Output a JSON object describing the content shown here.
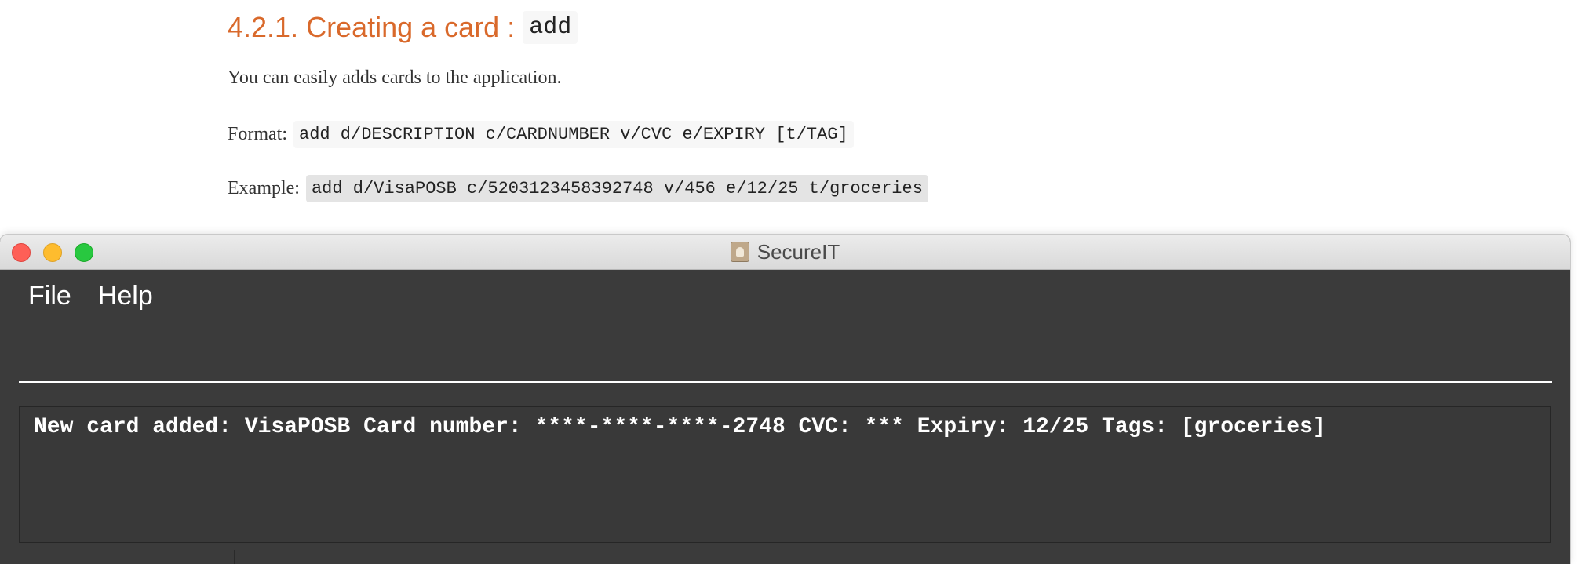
{
  "doc": {
    "heading": "4.2.1. Creating a card :",
    "heading_code": "add",
    "intro": "You can easily adds cards to the application.",
    "format_label": "Format:",
    "format_code": "add d/DESCRIPTION c/CARDNUMBER v/CVC e/EXPIRY [t/TAG]",
    "example_label": "Example:",
    "example_code": "add d/VisaPOSB c/5203123458392748 v/456 e/12/25 t/groceries"
  },
  "window": {
    "title": "SecureIT",
    "app_icon": "address-book-icon",
    "controls": [
      "close",
      "minimize",
      "zoom"
    ]
  },
  "menubar": {
    "items": [
      "File",
      "Help"
    ]
  },
  "command_box": {
    "value": "",
    "placeholder": ""
  },
  "result_display": {
    "text": "New card added: VisaPOSB Card number: ****-****-****-2748 CVC: *** Expiry: 12/25 Tags: [groceries]"
  },
  "colors": {
    "heading": "#d9692b",
    "window_bg": "#3b3b3b",
    "text_light": "#ffffff"
  }
}
